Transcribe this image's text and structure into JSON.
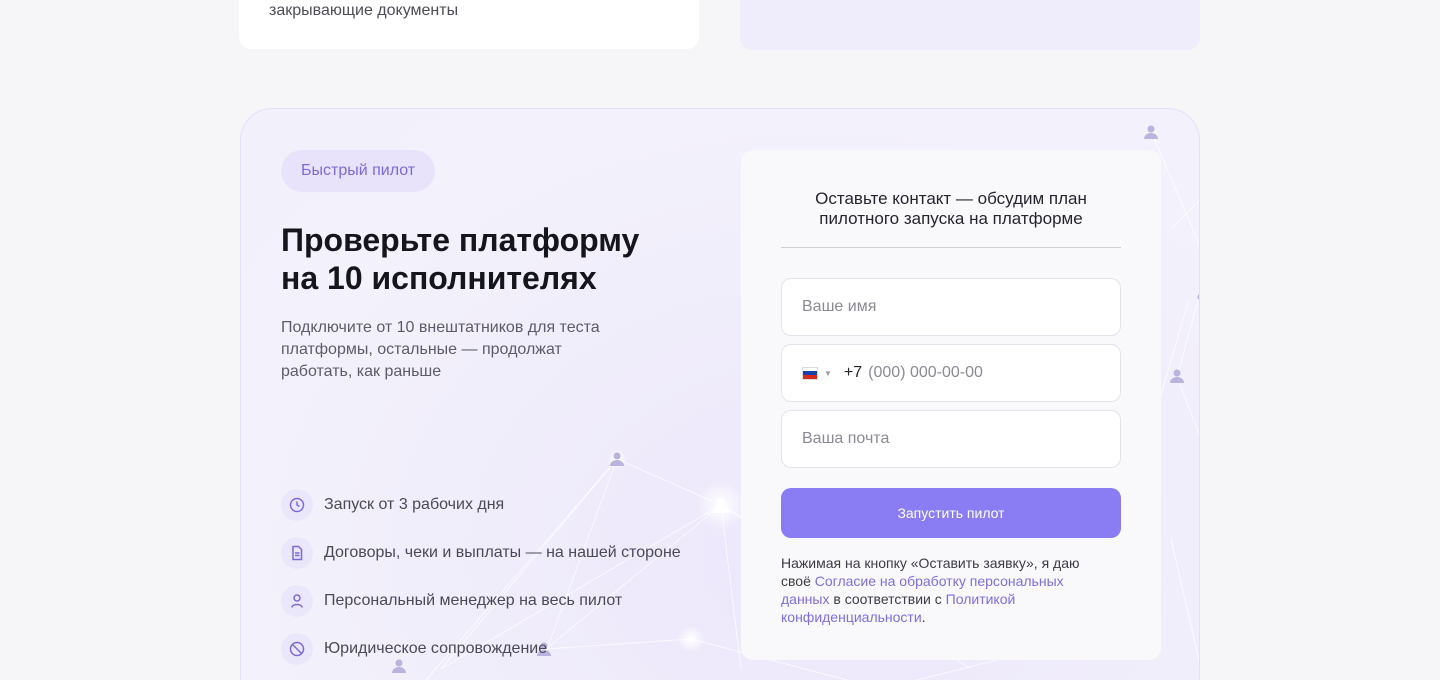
{
  "top_cards": {
    "left_text": "закрывающие документы"
  },
  "pilot": {
    "badge": "Быстрый пилот",
    "headline_line1": "Проверьте платформу",
    "headline_line2": "на 10 исполнителях",
    "lead_line1": "Подключите от 10 внештатников для теста",
    "lead_line2": "платформы, остальные — продолжат",
    "lead_line3": "работать, как раньше",
    "features": [
      {
        "icon": "clock-icon",
        "label": "Запуск от 3 рабочих дня"
      },
      {
        "icon": "document-icon",
        "label": "Договоры, чеки и выплаты — на нашей стороне"
      },
      {
        "icon": "person-icon",
        "label": "Персональный менеджер на весь пилот"
      },
      {
        "icon": "prohibited-icon",
        "label": "Юридическое сопровождение"
      }
    ]
  },
  "form": {
    "title_line1": "Оставьте контакт — обсудим план",
    "title_line2": "пилотного запуска на платформе",
    "name_placeholder": "Ваше имя",
    "phone_prefix": "+7",
    "phone_placeholder": "(000) 000-00-00",
    "email_placeholder": "Ваша почта",
    "submit_label": "Запустить пилот",
    "consent_text1": "Нажимая на кнопку «Оставить заявку», я даю своё ",
    "consent_link1": "Согласие на обработку персональных данных",
    "consent_text2": " в соответствии с ",
    "consent_link2": "Политикой конфиденциальности",
    "consent_text3": "."
  },
  "colors": {
    "accent": "#8a7cf3",
    "badge_bg": "#e8e3fb",
    "link": "#7d6ee3",
    "flag": [
      "#ffffff",
      "#1c3fa8",
      "#d52b1e"
    ]
  }
}
